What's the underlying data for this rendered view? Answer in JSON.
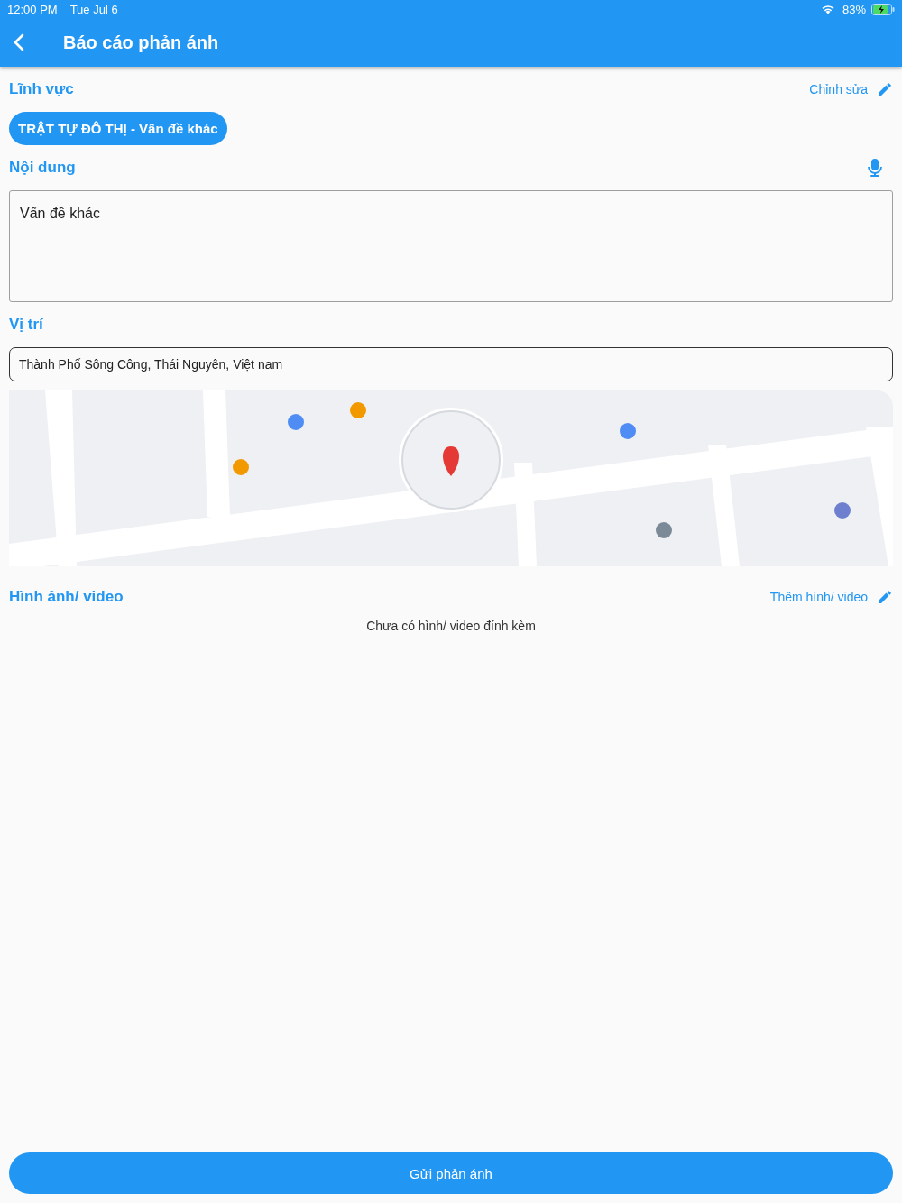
{
  "status_bar": {
    "time": "12:00 PM",
    "date": "Tue Jul 6",
    "battery": "83%"
  },
  "header": {
    "title": "Báo cáo phản ánh"
  },
  "field_section": {
    "title": "Lĩnh vực",
    "action": "Chỉnh sửa",
    "chip": "TRẬT TỰ ĐÔ THỊ - Vấn đề khác"
  },
  "content_section": {
    "title": "Nội dung",
    "value": "Vấn đề khác"
  },
  "location_section": {
    "title": "Vị trí",
    "value": "Thành Phố Sông Công, Thái Nguyên, Việt nam"
  },
  "media_section": {
    "title": "Hình ảnh/ video",
    "action": "Thêm hình/ video",
    "empty_text": "Chưa có hình/ video đính kèm"
  },
  "submit_button": "Gửi phản ánh"
}
